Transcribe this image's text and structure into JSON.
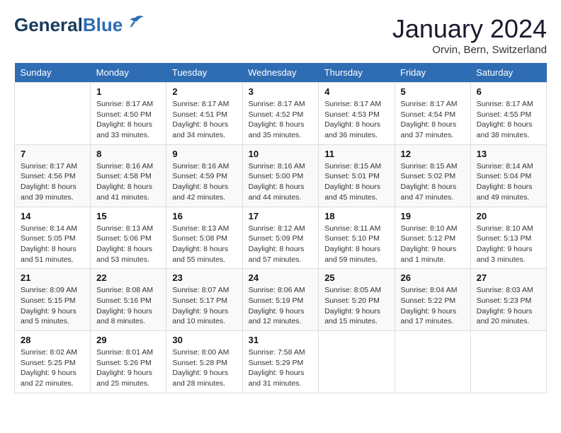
{
  "header": {
    "logo_general": "General",
    "logo_blue": "Blue",
    "month_title": "January 2024",
    "location": "Orvin, Bern, Switzerland"
  },
  "days_of_week": [
    "Sunday",
    "Monday",
    "Tuesday",
    "Wednesday",
    "Thursday",
    "Friday",
    "Saturday"
  ],
  "weeks": [
    [
      {
        "day": "",
        "sunrise": "",
        "sunset": "",
        "daylight": ""
      },
      {
        "day": "1",
        "sunrise": "Sunrise: 8:17 AM",
        "sunset": "Sunset: 4:50 PM",
        "daylight": "Daylight: 8 hours and 33 minutes."
      },
      {
        "day": "2",
        "sunrise": "Sunrise: 8:17 AM",
        "sunset": "Sunset: 4:51 PM",
        "daylight": "Daylight: 8 hours and 34 minutes."
      },
      {
        "day": "3",
        "sunrise": "Sunrise: 8:17 AM",
        "sunset": "Sunset: 4:52 PM",
        "daylight": "Daylight: 8 hours and 35 minutes."
      },
      {
        "day": "4",
        "sunrise": "Sunrise: 8:17 AM",
        "sunset": "Sunset: 4:53 PM",
        "daylight": "Daylight: 8 hours and 36 minutes."
      },
      {
        "day": "5",
        "sunrise": "Sunrise: 8:17 AM",
        "sunset": "Sunset: 4:54 PM",
        "daylight": "Daylight: 8 hours and 37 minutes."
      },
      {
        "day": "6",
        "sunrise": "Sunrise: 8:17 AM",
        "sunset": "Sunset: 4:55 PM",
        "daylight": "Daylight: 8 hours and 38 minutes."
      }
    ],
    [
      {
        "day": "7",
        "sunrise": "Sunrise: 8:17 AM",
        "sunset": "Sunset: 4:56 PM",
        "daylight": "Daylight: 8 hours and 39 minutes."
      },
      {
        "day": "8",
        "sunrise": "Sunrise: 8:16 AM",
        "sunset": "Sunset: 4:58 PM",
        "daylight": "Daylight: 8 hours and 41 minutes."
      },
      {
        "day": "9",
        "sunrise": "Sunrise: 8:16 AM",
        "sunset": "Sunset: 4:59 PM",
        "daylight": "Daylight: 8 hours and 42 minutes."
      },
      {
        "day": "10",
        "sunrise": "Sunrise: 8:16 AM",
        "sunset": "Sunset: 5:00 PM",
        "daylight": "Daylight: 8 hours and 44 minutes."
      },
      {
        "day": "11",
        "sunrise": "Sunrise: 8:15 AM",
        "sunset": "Sunset: 5:01 PM",
        "daylight": "Daylight: 8 hours and 45 minutes."
      },
      {
        "day": "12",
        "sunrise": "Sunrise: 8:15 AM",
        "sunset": "Sunset: 5:02 PM",
        "daylight": "Daylight: 8 hours and 47 minutes."
      },
      {
        "day": "13",
        "sunrise": "Sunrise: 8:14 AM",
        "sunset": "Sunset: 5:04 PM",
        "daylight": "Daylight: 8 hours and 49 minutes."
      }
    ],
    [
      {
        "day": "14",
        "sunrise": "Sunrise: 8:14 AM",
        "sunset": "Sunset: 5:05 PM",
        "daylight": "Daylight: 8 hours and 51 minutes."
      },
      {
        "day": "15",
        "sunrise": "Sunrise: 8:13 AM",
        "sunset": "Sunset: 5:06 PM",
        "daylight": "Daylight: 8 hours and 53 minutes."
      },
      {
        "day": "16",
        "sunrise": "Sunrise: 8:13 AM",
        "sunset": "Sunset: 5:08 PM",
        "daylight": "Daylight: 8 hours and 55 minutes."
      },
      {
        "day": "17",
        "sunrise": "Sunrise: 8:12 AM",
        "sunset": "Sunset: 5:09 PM",
        "daylight": "Daylight: 8 hours and 57 minutes."
      },
      {
        "day": "18",
        "sunrise": "Sunrise: 8:11 AM",
        "sunset": "Sunset: 5:10 PM",
        "daylight": "Daylight: 8 hours and 59 minutes."
      },
      {
        "day": "19",
        "sunrise": "Sunrise: 8:10 AM",
        "sunset": "Sunset: 5:12 PM",
        "daylight": "Daylight: 9 hours and 1 minute."
      },
      {
        "day": "20",
        "sunrise": "Sunrise: 8:10 AM",
        "sunset": "Sunset: 5:13 PM",
        "daylight": "Daylight: 9 hours and 3 minutes."
      }
    ],
    [
      {
        "day": "21",
        "sunrise": "Sunrise: 8:09 AM",
        "sunset": "Sunset: 5:15 PM",
        "daylight": "Daylight: 9 hours and 5 minutes."
      },
      {
        "day": "22",
        "sunrise": "Sunrise: 8:08 AM",
        "sunset": "Sunset: 5:16 PM",
        "daylight": "Daylight: 9 hours and 8 minutes."
      },
      {
        "day": "23",
        "sunrise": "Sunrise: 8:07 AM",
        "sunset": "Sunset: 5:17 PM",
        "daylight": "Daylight: 9 hours and 10 minutes."
      },
      {
        "day": "24",
        "sunrise": "Sunrise: 8:06 AM",
        "sunset": "Sunset: 5:19 PM",
        "daylight": "Daylight: 9 hours and 12 minutes."
      },
      {
        "day": "25",
        "sunrise": "Sunrise: 8:05 AM",
        "sunset": "Sunset: 5:20 PM",
        "daylight": "Daylight: 9 hours and 15 minutes."
      },
      {
        "day": "26",
        "sunrise": "Sunrise: 8:04 AM",
        "sunset": "Sunset: 5:22 PM",
        "daylight": "Daylight: 9 hours and 17 minutes."
      },
      {
        "day": "27",
        "sunrise": "Sunrise: 8:03 AM",
        "sunset": "Sunset: 5:23 PM",
        "daylight": "Daylight: 9 hours and 20 minutes."
      }
    ],
    [
      {
        "day": "28",
        "sunrise": "Sunrise: 8:02 AM",
        "sunset": "Sunset: 5:25 PM",
        "daylight": "Daylight: 9 hours and 22 minutes."
      },
      {
        "day": "29",
        "sunrise": "Sunrise: 8:01 AM",
        "sunset": "Sunset: 5:26 PM",
        "daylight": "Daylight: 9 hours and 25 minutes."
      },
      {
        "day": "30",
        "sunrise": "Sunrise: 8:00 AM",
        "sunset": "Sunset: 5:28 PM",
        "daylight": "Daylight: 9 hours and 28 minutes."
      },
      {
        "day": "31",
        "sunrise": "Sunrise: 7:58 AM",
        "sunset": "Sunset: 5:29 PM",
        "daylight": "Daylight: 9 hours and 31 minutes."
      },
      {
        "day": "",
        "sunrise": "",
        "sunset": "",
        "daylight": ""
      },
      {
        "day": "",
        "sunrise": "",
        "sunset": "",
        "daylight": ""
      },
      {
        "day": "",
        "sunrise": "",
        "sunset": "",
        "daylight": ""
      }
    ]
  ]
}
